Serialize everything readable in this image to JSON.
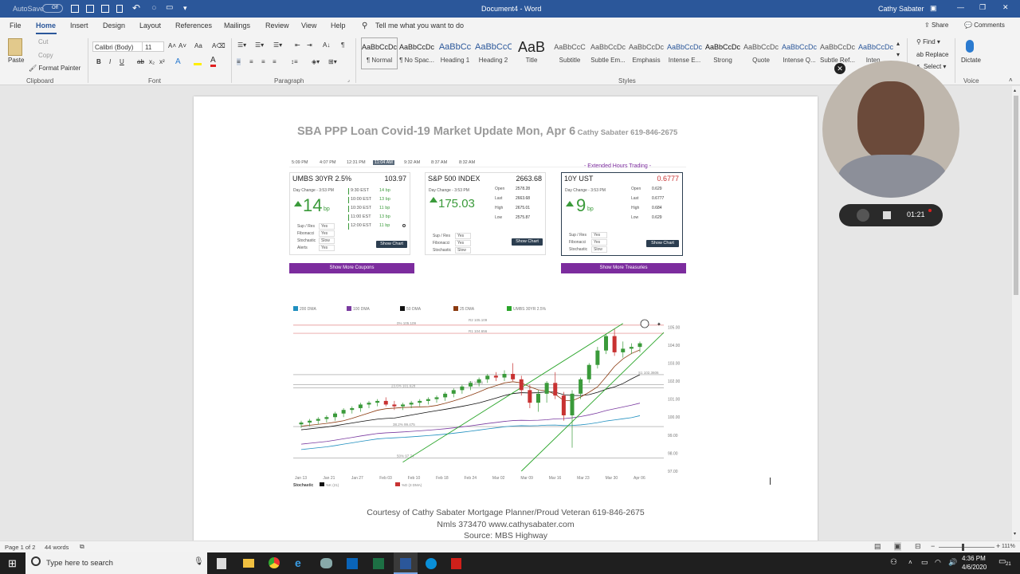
{
  "title_bar": {
    "autosave_label": "AutoSave",
    "autosave_state": "Off",
    "document_title": "Document4 - Word",
    "user_name": "Cathy Sabater"
  },
  "tabs": [
    "File",
    "Home",
    "Insert",
    "Design",
    "Layout",
    "References",
    "Mailings",
    "Review",
    "View",
    "Help"
  ],
  "tell_me": "Tell me what you want to do",
  "share_label": "Share",
  "comments_label": "Comments",
  "clipboard": {
    "paste": "Paste",
    "cut": "Cut",
    "copy": "Copy",
    "format_painter": "Format Painter",
    "label": "Clipboard"
  },
  "font": {
    "name": "Calibri (Body)",
    "size": "11",
    "label": "Font"
  },
  "paragraph_label": "Paragraph",
  "styles": [
    {
      "sample": "AaBbCcDc",
      "name": "¶ Normal"
    },
    {
      "sample": "AaBbCcDc",
      "name": "¶ No Spac..."
    },
    {
      "sample": "AaBbCc",
      "name": "Heading 1"
    },
    {
      "sample": "AaBbCcC",
      "name": "Heading 2"
    },
    {
      "sample": "AaB",
      "name": "Title"
    },
    {
      "sample": "AaBbCcC",
      "name": "Subtitle"
    },
    {
      "sample": "AaBbCcDc",
      "name": "Subtle Em..."
    },
    {
      "sample": "AaBbCcDc",
      "name": "Emphasis"
    },
    {
      "sample": "AaBbCcDc",
      "name": "Intense E..."
    },
    {
      "sample": "AaBbCcDc",
      "name": "Strong"
    },
    {
      "sample": "AaBbCcDc",
      "name": "Quote"
    },
    {
      "sample": "AaBbCcDc",
      "name": "Intense Q..."
    },
    {
      "sample": "AaBbCcDc",
      "name": "Subtle Ref..."
    },
    {
      "sample": "AaBbCcDc",
      "name": "Inten..."
    }
  ],
  "styles_label": "Styles",
  "editing": {
    "find": "Find",
    "replace": "Replace",
    "select": "Select"
  },
  "voice": {
    "dictate": "Dictate",
    "label": "Voice"
  },
  "doc": {
    "heading": "SBA PPP Loan Covid-19 Market Update Mon, Apr 6",
    "heading_contact": "Cathy Sabater 619-846-2675",
    "times": [
      "5:09 PM",
      "4:07 PM",
      "12:31 PM",
      "11:04 AM",
      "9:32 AM",
      "8:37 AM",
      "8:32 AM"
    ],
    "umbs": {
      "name": "UMBS 30YR 2.5%",
      "value": "103.97",
      "day_change": "Day Change - 3:53 PM",
      "change": "14",
      "unit": "bp",
      "intraday": [
        [
          "9:30 EST",
          "14 bp"
        ],
        [
          "10:00 EST",
          "13 bp"
        ],
        [
          "10:30 EST",
          "11 bp"
        ],
        [
          "11:00 EST",
          "13 bp"
        ],
        [
          "12:00 EST",
          "11 bp"
        ]
      ],
      "indicators": [
        [
          "Sup / Res",
          "Yes"
        ],
        [
          "Fibonacci",
          "Yes"
        ],
        [
          "Stochastic",
          "Slow"
        ],
        [
          "Alerts",
          "Yes"
        ]
      ],
      "button": "Show Chart"
    },
    "sp500": {
      "name": "S&P 500 INDEX",
      "value": "2663.68",
      "day_change": "Day Change - 3:53 PM",
      "change": "175.03",
      "stats": [
        [
          "Open",
          "2578.28"
        ],
        [
          "Last",
          "2663.68"
        ],
        [
          "High",
          "2675.01"
        ],
        [
          "Low",
          "2575.87"
        ]
      ],
      "indicators": [
        [
          "Sup / Res",
          "Yes"
        ],
        [
          "Fibonacci",
          "Yes"
        ],
        [
          "Stochastic",
          "Slow"
        ]
      ],
      "button": "Show Chart"
    },
    "ext_hours": "- Extended Hours Trading -",
    "ust": {
      "name": "10Y UST",
      "value": "0.6777",
      "day_change": "Day Change - 3:53 PM",
      "change": "9",
      "unit": "bp",
      "stats": [
        [
          "Open",
          "0.629"
        ],
        [
          "Last",
          "0.6777"
        ],
        [
          "High",
          "0.684"
        ],
        [
          "Low",
          "0.629"
        ]
      ],
      "indicators": [
        [
          "Sup / Res",
          "Yes"
        ],
        [
          "Fibonacci",
          "Yes"
        ],
        [
          "Stochastic",
          "Slow"
        ]
      ],
      "button": "Show Chart"
    },
    "more_coupons": "Show More Coupons",
    "more_treasuries": "Show More Treasuries",
    "footer1": "Courtesy of Cathy Sabater Mortgage Planner/Proud Veteran 619-846-2675",
    "footer2": "Nmls 373470 www.cathysabater.com",
    "footer3": "Source:  MBS Highway"
  },
  "chart_data": {
    "type": "candlestick",
    "legend": [
      "200 DMA",
      "100 DMA",
      "50 DMA",
      "25 DMA",
      "UMBS 30YR 2.5%"
    ],
    "colors": {
      "up": "#3a9a3a",
      "down": "#c83232",
      "dma200": "#1f8fbf",
      "dma100": "#7a3aa0",
      "dma50": "#111111",
      "dma25": "#8b3a10",
      "trend": "#2aa52a"
    },
    "x_ticks": [
      "Jan 13",
      "Jan 21",
      "Jan 27",
      "Feb 03",
      "Feb 10",
      "Feb 18",
      "Feb 24",
      "Mar 02",
      "Mar 09",
      "Mar 16",
      "Mar 23",
      "Mar 30",
      "Apr 06"
    ],
    "y_ticks": [
      "105.00",
      "104.00",
      "103.00",
      "102.00",
      "101.00",
      "100.00",
      "99.00",
      "98.00",
      "97.00"
    ],
    "ylim": [
      97,
      105.5
    ],
    "levels": [
      {
        "label": "0% 105.109",
        "value": 105.109
      },
      {
        "label": "R2 105.109",
        "value": 105.109
      },
      {
        "label": "R1 104.656",
        "value": 104.656
      },
      {
        "label": "S2 101.8",
        "value": 101.8
      },
      {
        "label": "23.6% 101.628",
        "value": 101.628
      },
      {
        "label": "S1 102.3606",
        "value": 102.3606
      },
      {
        "label": "38.2% 99.475",
        "value": 99.475
      },
      {
        "label": "50% 97.74",
        "value": 97.74
      }
    ],
    "candles": [
      [
        99.6,
        99.8,
        99.4,
        99.7
      ],
      [
        99.7,
        99.9,
        99.5,
        99.8
      ],
      [
        99.8,
        100,
        99.6,
        99.9
      ],
      [
        99.9,
        100.1,
        99.7,
        100
      ],
      [
        100,
        100.3,
        99.8,
        100.2
      ],
      [
        100.2,
        100.5,
        100,
        100.4
      ],
      [
        100.4,
        100.6,
        100.2,
        100.5
      ],
      [
        100.5,
        100.8,
        100.3,
        100.7
      ],
      [
        100.7,
        100.9,
        100.5,
        100.8
      ],
      [
        100.8,
        101,
        100.6,
        100.9
      ],
      [
        100.9,
        101.1,
        100.6,
        100.7
      ],
      [
        100.7,
        100.9,
        100.4,
        100.6
      ],
      [
        100.6,
        100.8,
        100.4,
        100.7
      ],
      [
        100.7,
        100.9,
        100.5,
        100.8
      ],
      [
        100.8,
        101,
        100.6,
        100.9
      ],
      [
        100.9,
        101.1,
        100.7,
        101
      ],
      [
        101,
        101.2,
        100.8,
        101.1
      ],
      [
        101.1,
        101.4,
        100.9,
        101.3
      ],
      [
        101.3,
        101.6,
        101.1,
        101.5
      ],
      [
        101.5,
        101.8,
        101.3,
        101.7
      ],
      [
        101.7,
        102,
        101.5,
        101.9
      ],
      [
        101.9,
        102.2,
        101.7,
        102.1
      ],
      [
        102.1,
        102.4,
        101.9,
        102.3
      ],
      [
        102.3,
        102.5,
        102,
        102.2
      ],
      [
        102.2,
        102.6,
        102,
        102.4
      ],
      [
        102.4,
        103,
        102,
        102.1
      ],
      [
        102.1,
        102.3,
        101.2,
        101.5
      ],
      [
        101.5,
        101.8,
        100.5,
        100.8
      ],
      [
        100.8,
        101.5,
        100.3,
        101.3
      ],
      [
        101.3,
        102,
        100.8,
        101.9
      ],
      [
        101.9,
        102.5,
        101,
        101.2
      ],
      [
        101.2,
        101.4,
        99.8,
        100.1
      ],
      [
        100.1,
        101.5,
        98.3,
        101.3
      ],
      [
        101.3,
        102.2,
        101,
        102.1
      ],
      [
        102.1,
        103,
        101.9,
        102.9
      ],
      [
        102.9,
        103.9,
        102.7,
        103.7
      ],
      [
        103.7,
        104.6,
        103.5,
        104.5
      ],
      [
        104.5,
        104.9,
        103.4,
        103.6
      ],
      [
        103.6,
        104.2,
        103.3,
        103.8
      ],
      [
        103.8,
        104.1,
        103.5,
        103.9
      ],
      [
        103.9,
        104.2,
        103.6,
        104.1
      ]
    ],
    "stochastic_legend": [
      "%K (21)",
      "%D (3 DMA)"
    ],
    "stochastic_label": "Stochastic"
  },
  "video_timer": "01:21",
  "status": {
    "page": "Page 1 of 2",
    "words": "44 words",
    "zoom": "111%"
  },
  "taskbar": {
    "search": "Type here to search",
    "time": "4:36 PM",
    "date": "4/6/2020",
    "notif": "21"
  }
}
